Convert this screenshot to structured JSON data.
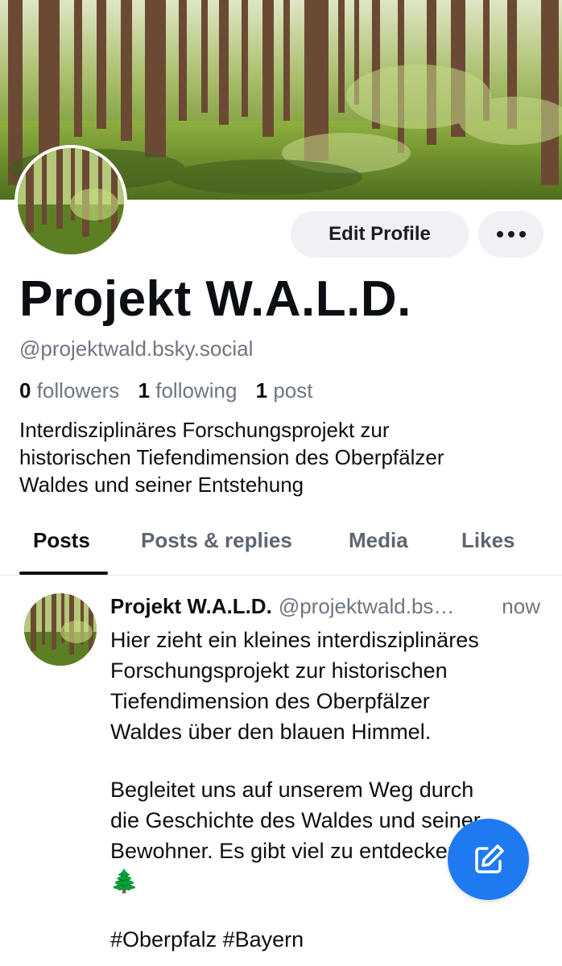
{
  "profile": {
    "display_name": "Projekt W.A.L.D.",
    "handle": "@projektwald.bsky.social",
    "followers_count": "0",
    "followers_label": "followers",
    "following_count": "1",
    "following_label": "following",
    "posts_count": "1",
    "posts_label": "post",
    "bio_lines": [
      "Interdisziplinäres Forschungsprojekt zur",
      "historischen Tiefendimension des Oberpfälzer",
      "Waldes und seiner Entstehung"
    ]
  },
  "actions": {
    "edit_profile_label": "Edit Profile",
    "more_icon": "ellipsis-icon"
  },
  "tabs": [
    {
      "label": "Posts",
      "active": true
    },
    {
      "label": "Posts & replies",
      "active": false
    },
    {
      "label": "Media",
      "active": false
    },
    {
      "label": "Likes",
      "active": false
    }
  ],
  "post": {
    "author": "Projekt W.A.L.D.",
    "handle": "@projektwald.bs…",
    "time": "now",
    "paragraphs": [
      [
        "Hier zieht ein kleines interdisziplinäres",
        "Forschungsprojekt zur historischen",
        "Tiefendimension des Oberpfälzer",
        "Waldes über den blauen Himmel."
      ],
      [
        "Begleitet uns auf unserem Weg durch",
        "die Geschichte des Waldes und seiner",
        "Bewohner. Es gibt viel zu entdecken!",
        "🌲"
      ],
      [
        "#Oberpfalz #Bayern"
      ]
    ]
  },
  "fab": {
    "icon": "compose-icon",
    "color": "#1f7af2"
  }
}
